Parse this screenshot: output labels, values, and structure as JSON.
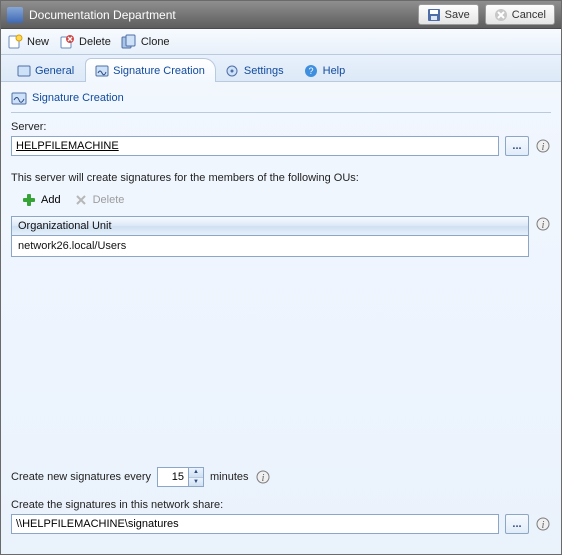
{
  "titlebar": {
    "title": "Documentation Department",
    "save_label": "Save",
    "cancel_label": "Cancel"
  },
  "toolbar": {
    "new_label": "New",
    "delete_label": "Delete",
    "clone_label": "Clone"
  },
  "tabs": {
    "general": "General",
    "signature_creation": "Signature Creation",
    "settings": "Settings",
    "help": "Help"
  },
  "section": {
    "title": "Signature Creation"
  },
  "server": {
    "label": "Server:",
    "value": "HELPFILEMACHINE",
    "browse": "..."
  },
  "ou": {
    "description": "This server will create signatures for the members of the following OUs:",
    "add_label": "Add",
    "delete_label": "Delete",
    "column_header": "Organizational Unit",
    "rows": [
      "network26.local/Users"
    ]
  },
  "interval": {
    "prefix": "Create new signatures every",
    "value": "15",
    "suffix": "minutes"
  },
  "share": {
    "label": "Create the signatures in this network share:",
    "value": "\\\\HELPFILEMACHINE\\signatures",
    "browse": "..."
  }
}
